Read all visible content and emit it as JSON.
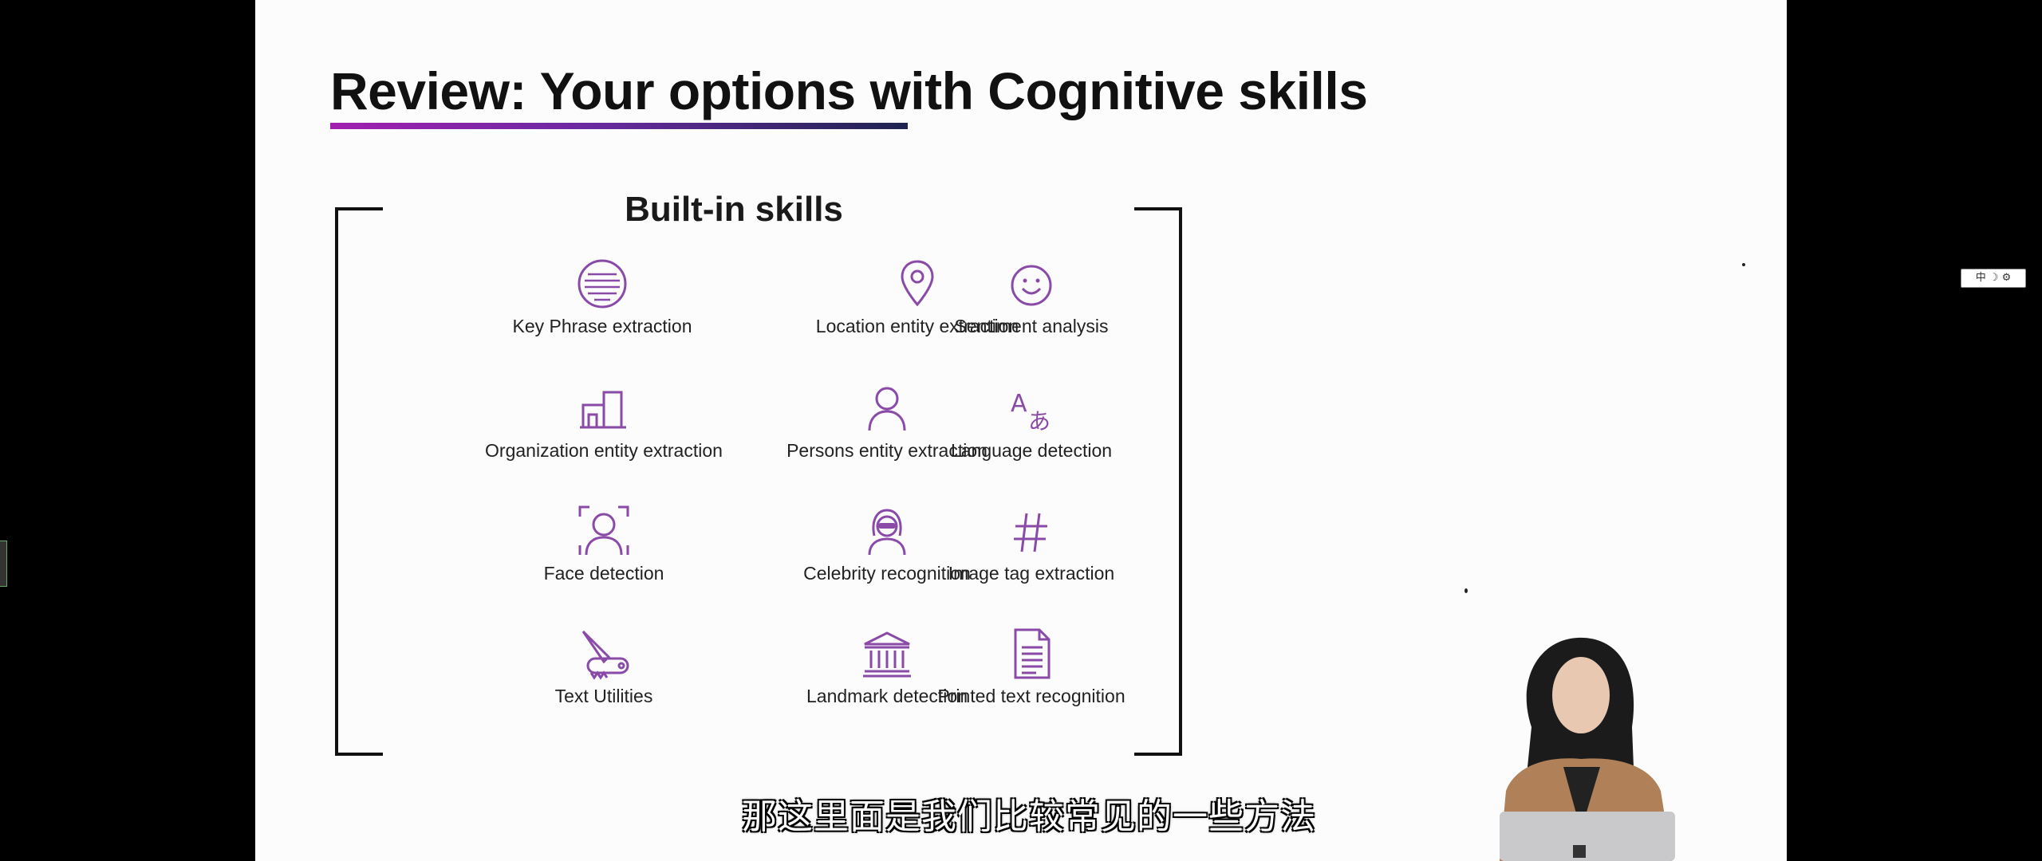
{
  "slide": {
    "title": "Review: Your options with Cognitive skills",
    "group_title": "Built-in skills",
    "skills": [
      {
        "label": "Key Phrase extraction",
        "icon": "key-phrase-icon"
      },
      {
        "label": "Location entity extraction",
        "icon": "location-pin-icon"
      },
      {
        "label": "Sentiment analysis",
        "icon": "smiley-icon"
      },
      {
        "label": "Organization entity extraction",
        "icon": "buildings-icon"
      },
      {
        "label": "Persons entity extraction",
        "icon": "person-icon"
      },
      {
        "label": "Language detection",
        "icon": "language-icon"
      },
      {
        "label": "Face detection",
        "icon": "face-scan-icon"
      },
      {
        "label": "Celebrity recognition",
        "icon": "celebrity-icon"
      },
      {
        "label": "Image tag extraction",
        "icon": "hashtag-icon"
      },
      {
        "label": "Text Utilities",
        "icon": "pocket-knife-icon"
      },
      {
        "label": "Landmark detection",
        "icon": "landmark-icon"
      },
      {
        "label": "Printed text recognition",
        "icon": "document-icon"
      }
    ],
    "accent_color": "#8a4aa8",
    "underline_gradient": [
      "#a11fb0",
      "#1e2350"
    ]
  },
  "video": {
    "subtitle": "那这里面是我们比较常见的一些方法"
  },
  "ime_toolbar": {
    "text": "中 ☽ ⚙"
  }
}
